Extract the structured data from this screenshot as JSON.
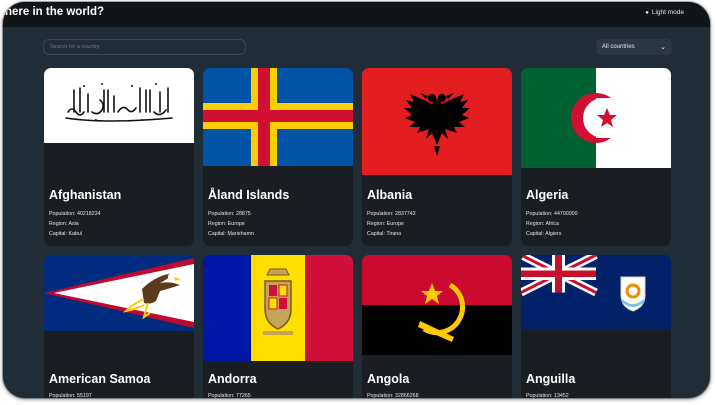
{
  "header": {
    "title": "here in the world?",
    "mode_label": "Light mode"
  },
  "search": {
    "placeholder": "Search for a country"
  },
  "filter": {
    "selected": "All countries"
  },
  "labels": {
    "population": "Population:",
    "region": "Region:",
    "capital": "Capital:"
  },
  "countries": [
    {
      "name": "Afghanistan",
      "population": "40218234",
      "region": "Asia",
      "capital": "Kabul",
      "flag": "afghanistan-flag"
    },
    {
      "name": "Åland Islands",
      "population": "28875",
      "region": "Europe",
      "capital": "Mariehamn",
      "flag": "aland-flag"
    },
    {
      "name": "Albania",
      "population": "2837743",
      "region": "Europe",
      "capital": "Tirana",
      "flag": "albania-flag"
    },
    {
      "name": "Algeria",
      "population": "44700000",
      "region": "Africa",
      "capital": "Algiers",
      "flag": "algeria-flag"
    },
    {
      "name": "American Samoa",
      "population": "55197",
      "flag": "american-samoa-flag"
    },
    {
      "name": "Andorra",
      "population": "77265",
      "flag": "andorra-flag"
    },
    {
      "name": "Angola",
      "population": "32866268",
      "flag": "angola-flag"
    },
    {
      "name": "Anguilla",
      "population": "13452",
      "flag": "anguilla-flag"
    }
  ],
  "colors": {
    "background": "#202c36",
    "header": "#111518",
    "card": "#1a1d21",
    "text": "#ffffff"
  }
}
